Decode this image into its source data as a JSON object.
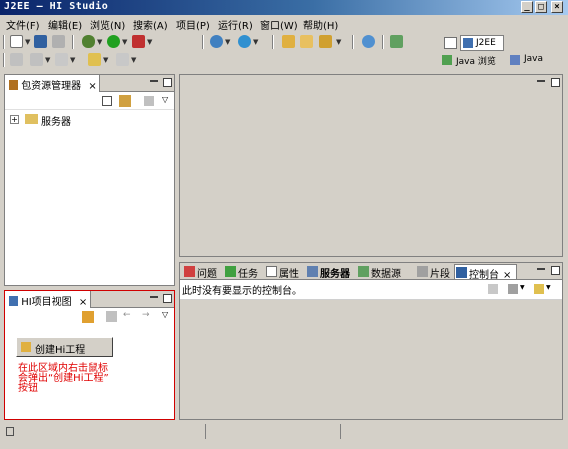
{
  "window": {
    "title": "J2EE — HI Studio"
  },
  "menu": [
    "文件(F)",
    "编辑(E)",
    "浏览(N)",
    "搜索(A)",
    "项目(P)",
    "运行(R)",
    "窗口(W)",
    "帮助(H)"
  ],
  "perspectives": {
    "j2ee": "J2EE",
    "java_browse": "Java 浏览",
    "java": "Java"
  },
  "package_explorer": {
    "title": "包资源管理器",
    "tree": [
      {
        "label": "服务器"
      }
    ]
  },
  "hi_project_view": {
    "title": "HI项目视图",
    "create_button": "创建Hi工程",
    "hint_lines": [
      "在此区域内右击鼠标",
      "会弹出“创建Hi工程”",
      "按钮"
    ]
  },
  "bottom_tabs": [
    "问题",
    "任务",
    "属性",
    "服务器",
    "数据源",
    "片段",
    "控制台"
  ],
  "console": {
    "message": "此时没有要显示的控制台。"
  },
  "colors": {
    "hint_red": "#e00000",
    "title_dark": "#0a246a"
  }
}
